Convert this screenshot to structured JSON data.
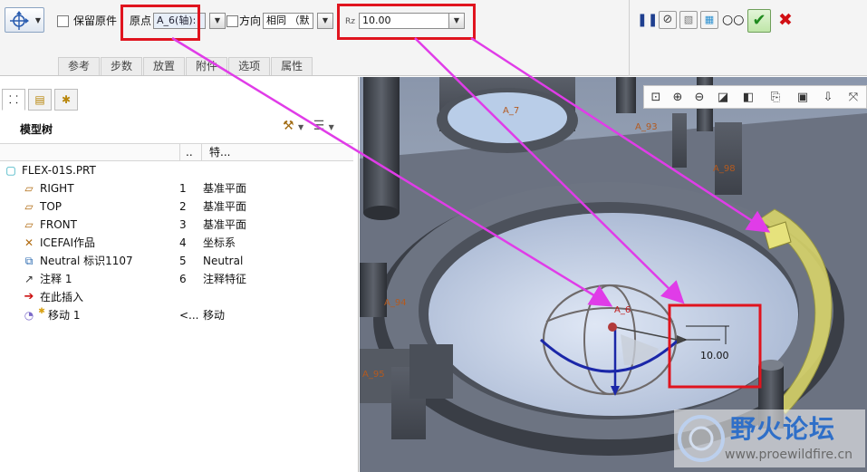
{
  "dashboard": {
    "keep_original_label": "保留原件",
    "origin_label": "原点",
    "origin_value": "A_6(轴):",
    "direction_label": "方向",
    "direction_value": "相同 （默",
    "rz_label": "Rz",
    "rz_value": "10.00",
    "tabs": [
      "参考",
      "步数",
      "放置",
      "附件",
      "选项",
      "属性"
    ]
  },
  "model_tree": {
    "title": "模型树",
    "col_dots": "..",
    "col_feature": "特...",
    "root": "FLEX-01S.PRT",
    "items": [
      {
        "name": "RIGHT",
        "num": "1",
        "type": "基准平面"
      },
      {
        "name": "TOP",
        "num": "2",
        "type": "基准平面"
      },
      {
        "name": "FRONT",
        "num": "3",
        "type": "基准平面"
      },
      {
        "name": "ICEFAI作品",
        "num": "4",
        "type": "坐标系"
      },
      {
        "name": "Neutral 标识1107",
        "num": "5",
        "type": "Neutral"
      },
      {
        "name": "注释 1",
        "num": "6",
        "type": "注释特征"
      },
      {
        "name": "在此插入",
        "num": "",
        "type": ""
      },
      {
        "name": "移动 1",
        "num": "<...",
        "type": "移动"
      }
    ]
  },
  "viewport": {
    "labels": {
      "a7": "A_7",
      "a93": "A_93",
      "a98": "A_98",
      "a6": "A_6",
      "a94": "A_94",
      "a95": "A_95",
      "dim": "10.00"
    }
  },
  "watermark": {
    "cn": "野火论坛",
    "url": "www.proewildfire.cn"
  },
  "colors": {
    "highlight_red": "#e0141e",
    "arrow_magenta": "#e03ce8",
    "accent_green": "#1e8a1e",
    "cancel_red": "#d10f14"
  }
}
